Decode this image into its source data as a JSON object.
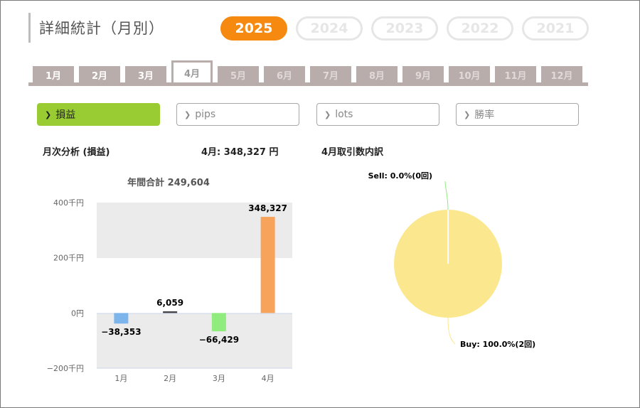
{
  "header": {
    "title": "詳細統計（月別）"
  },
  "years": [
    {
      "label": "2025",
      "active": true
    },
    {
      "label": "2024",
      "active": false
    },
    {
      "label": "2023",
      "active": false
    },
    {
      "label": "2022",
      "active": false
    },
    {
      "label": "2021",
      "active": false
    }
  ],
  "months": [
    "1月",
    "2月",
    "3月",
    "4月",
    "5月",
    "6月",
    "7月",
    "8月",
    "9月",
    "10月",
    "11月",
    "12月"
  ],
  "selected_month": "4月",
  "metrics": [
    {
      "label": "損益",
      "active": true
    },
    {
      "label": "pips",
      "active": false
    },
    {
      "label": "lots",
      "active": false
    },
    {
      "label": "勝率",
      "active": false
    }
  ],
  "summary": {
    "section_label": "月次分析 (損益)",
    "month_value": "4月:  348,327 円",
    "trades_label": "4月取引数内訳"
  },
  "colors": {
    "accent": "#f6890f",
    "metric_active": "#99cc33",
    "tab": "#b9adab"
  },
  "chart_data": [
    {
      "type": "bar",
      "title": "年間合計 249,604",
      "categories": [
        "1月",
        "2月",
        "3月",
        "4月"
      ],
      "values": [
        -38353,
        6059,
        -66429,
        348327
      ],
      "value_labels": [
        "−38,353",
        "6,059",
        "−66,429",
        "348,327"
      ],
      "bar_colors": [
        "#7cb5ec",
        "#434348",
        "#90ed7d",
        "#f7a35c"
      ],
      "yticks": [
        {
          "value": 400000,
          "label": "400千円"
        },
        {
          "value": 200000,
          "label": "200千円"
        },
        {
          "value": 0,
          "label": "0円"
        },
        {
          "value": -200000,
          "label": "−200千円"
        }
      ],
      "ylim": [
        -200000,
        400000
      ],
      "grid": true
    },
    {
      "type": "pie",
      "slices": [
        {
          "name": "Sell",
          "label": "Sell: 0.0%(0回)",
          "percent": 0.0,
          "count": 0,
          "color": "#90ed7d"
        },
        {
          "name": "Buy",
          "label": "Buy: 100.0%(2回)",
          "percent": 100.0,
          "count": 2,
          "color": "#fbe88e"
        }
      ]
    }
  ]
}
